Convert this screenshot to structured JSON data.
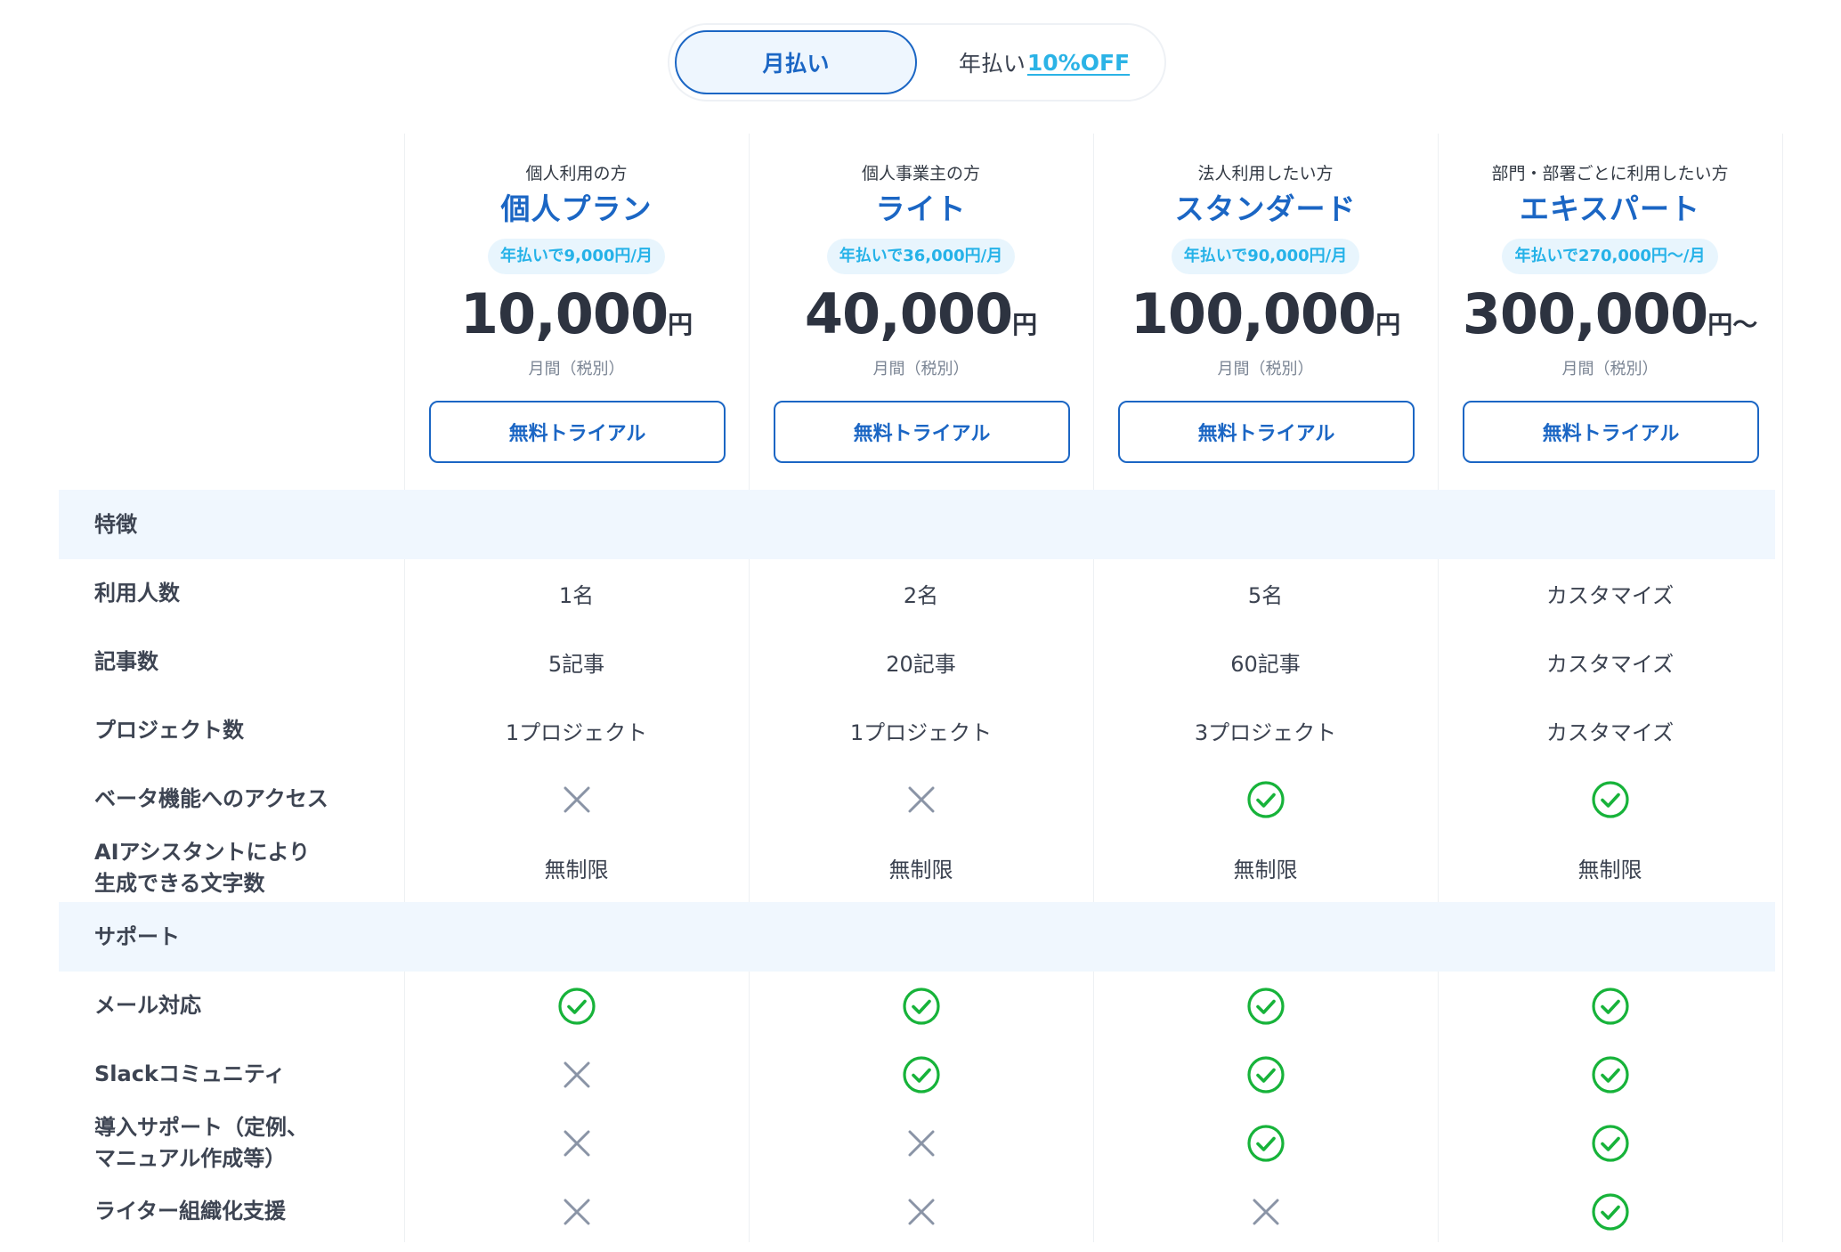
{
  "billing_toggle": {
    "monthly_label": "月払い",
    "yearly_label": "年払い",
    "yearly_discount": "10%OFF",
    "selected": "monthly"
  },
  "plans": [
    {
      "audience": "個人利用の方",
      "name": "個人プラン",
      "annual_note": "年払いで9,000円/月",
      "price": "10,000",
      "unit": "円",
      "period": "月間（税別）",
      "cta": "無料トライアル"
    },
    {
      "audience": "個人事業主の方",
      "name": "ライト",
      "annual_note": "年払いで36,000円/月",
      "price": "40,000",
      "unit": "円",
      "period": "月間（税別）",
      "cta": "無料トライアル"
    },
    {
      "audience": "法人利用したい方",
      "name": "スタンダード",
      "annual_note": "年払いで90,000円/月",
      "price": "100,000",
      "unit": "円",
      "period": "月間（税別）",
      "cta": "無料トライアル"
    },
    {
      "audience": "部門・部署ごとに利用したい方",
      "name": "エキスパート",
      "annual_note": "年払いで270,000円〜/月",
      "price": "300,000",
      "unit": "円〜",
      "period": "月間（税別）",
      "cta": "無料トライアル"
    }
  ],
  "sections": [
    {
      "title": "特徴",
      "rows": [
        {
          "label": "利用人数",
          "values": [
            "1名",
            "2名",
            "5名",
            "カスタマイズ"
          ]
        },
        {
          "label": "記事数",
          "values": [
            "5記事",
            "20記事",
            "60記事",
            "カスタマイズ"
          ]
        },
        {
          "label": "プロジェクト数",
          "values": [
            "1プロジェクト",
            "1プロジェクト",
            "3プロジェクト",
            "カスタマイズ"
          ]
        },
        {
          "label": "ベータ機能へのアクセス",
          "values": [
            "cross-icon",
            "cross-icon",
            "check-icon",
            "check-icon"
          ]
        },
        {
          "label": "AIアシスタントにより\n生成できる文字数",
          "values": [
            "無制限",
            "無制限",
            "無制限",
            "無制限"
          ]
        }
      ]
    },
    {
      "title": "サポート",
      "rows": [
        {
          "label": "メール対応",
          "values": [
            "check-icon",
            "check-icon",
            "check-icon",
            "check-icon"
          ]
        },
        {
          "label": "Slackコミュニティ",
          "values": [
            "cross-icon",
            "check-icon",
            "check-icon",
            "check-icon"
          ]
        },
        {
          "label": "導入サポート（定例、\nマニュアル作成等）",
          "values": [
            "cross-icon",
            "cross-icon",
            "check-icon",
            "check-icon"
          ]
        },
        {
          "label": "ライター組織化支援",
          "values": [
            "cross-icon",
            "cross-icon",
            "cross-icon",
            "check-icon"
          ]
        }
      ]
    }
  ],
  "colors": {
    "accent": "#1b66c4",
    "annual_badge_text": "#25b2e8",
    "annual_badge_bg": "#e8f5fd",
    "section_bg": "#f0f7fe",
    "check": "#17b33a",
    "cross": "#8a94a6"
  }
}
